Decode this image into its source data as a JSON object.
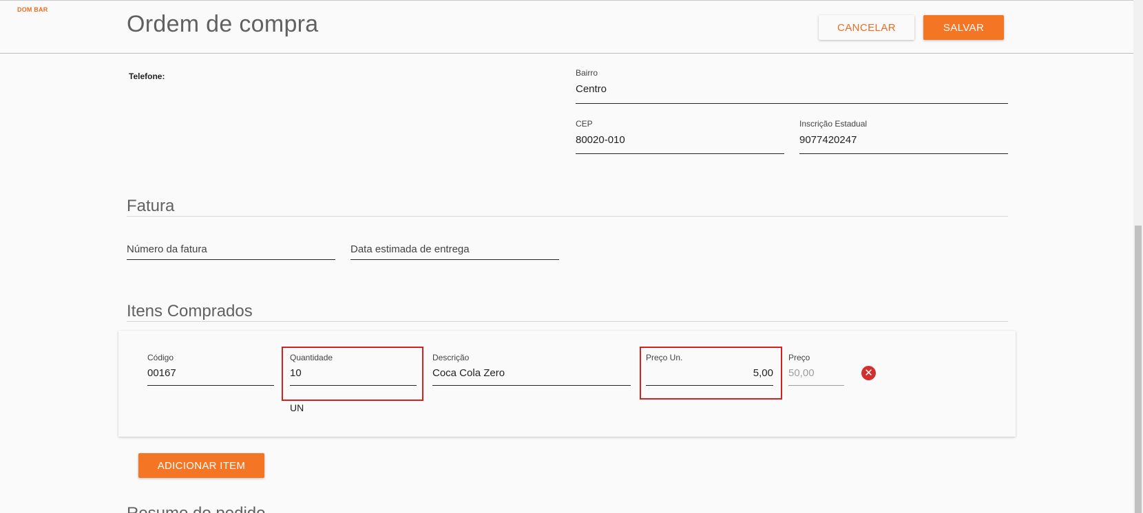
{
  "brand": "DOM BAR",
  "header": {
    "title": "Ordem de compra",
    "cancel_label": "CANCELAR",
    "save_label": "SALVAR"
  },
  "supplier": {
    "telefone_label": "Telefone:",
    "bairro": {
      "label": "Bairro",
      "value": "Centro"
    },
    "cep": {
      "label": "CEP",
      "value": "80020-010"
    },
    "inscricao": {
      "label": "Inscrição Estadual",
      "value": "9077420247"
    }
  },
  "fatura": {
    "title": "Fatura",
    "numero_placeholder": "Número da fatura",
    "data_placeholder": "Data estimada de entrega"
  },
  "items": {
    "title": "Itens Comprados",
    "rows": [
      {
        "codigo_label": "Código",
        "codigo": "00167",
        "quantidade_label": "Quantidade",
        "quantidade": "10",
        "unidade": "UN",
        "descricao_label": "Descrição",
        "descricao": "Coca Cola Zero",
        "preco_un_label": "Preço Un.",
        "preco_un": "5,00",
        "preco_label": "Preço",
        "preco": "50,00",
        "remove_icon": "close-circle-icon"
      }
    ],
    "add_label": "ADICIONAR ITEM"
  },
  "next_section_partial": "Resumo do pedido",
  "colors": {
    "accent": "#f47524",
    "highlight": "#d61f1f",
    "remove": "#d32f2f"
  }
}
